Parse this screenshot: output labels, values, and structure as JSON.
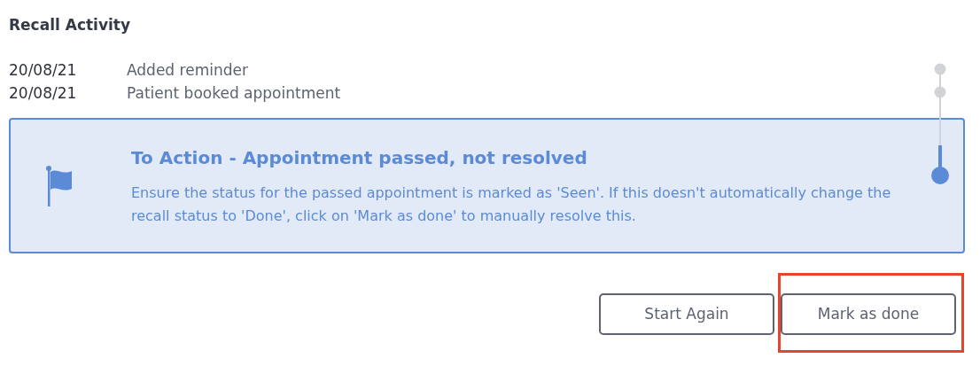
{
  "heading": "Recall Activity",
  "activities": [
    {
      "date": "20/08/21",
      "text": "Added reminder"
    },
    {
      "date": "20/08/21",
      "text": "Patient booked appointment"
    }
  ],
  "callout": {
    "title": "To Action - Appointment passed, not resolved",
    "text": "Ensure the status for the passed appointment is marked as 'Seen'. If this doesn't automatically change the recall status to 'Done', click on 'Mark as done' to manually resolve this."
  },
  "buttons": [
    {
      "label": "Start Again",
      "highlighted": false
    },
    {
      "label": "Mark as done",
      "highlighted": true
    }
  ]
}
